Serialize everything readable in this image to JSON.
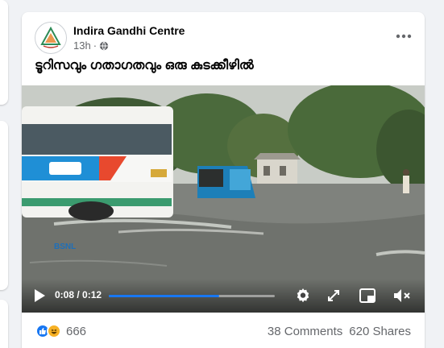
{
  "post": {
    "author": "Indira Gandhi Centre",
    "time": "13h",
    "separator": "·",
    "caption": "ടൂറിസവും ഗതാഗതവും ഒരു കുടക്കീഴിൽ",
    "more_icon": "more-horizontal-icon",
    "privacy_icon": "globe-icon"
  },
  "video": {
    "current_time": "0:08",
    "duration": "0:12",
    "time_display": "0:08 / 0:12",
    "progress": 0.667,
    "bus_banner": "BSNL",
    "controls": [
      "play-icon",
      "settings-icon",
      "fullscreen-icon",
      "mini-player-icon",
      "mute-icon"
    ]
  },
  "engagement": {
    "reaction_count": "666",
    "comments": "38 Comments",
    "shares": "620 Shares"
  },
  "colors": {
    "accent": "#1877f2",
    "text_secondary": "#65676b",
    "reaction_haha": "#f7b125"
  }
}
